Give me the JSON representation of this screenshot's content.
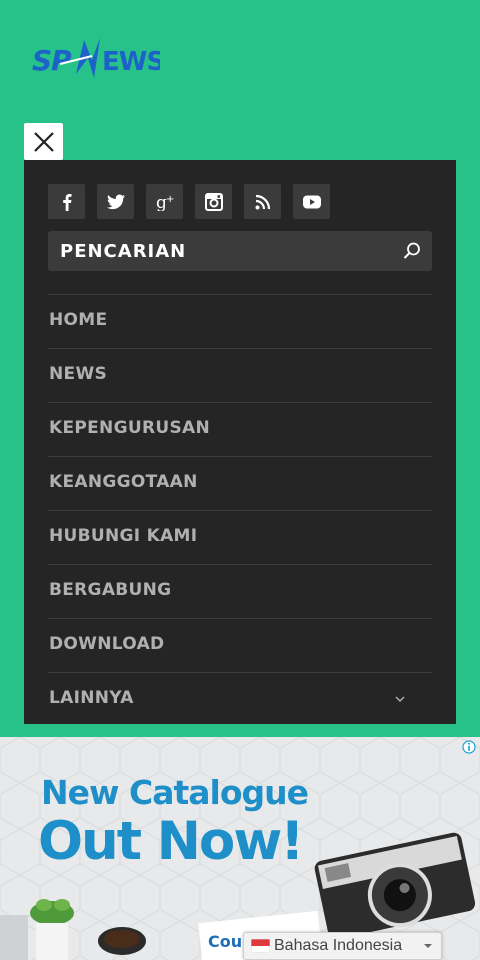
{
  "logo": {
    "text": "SPNEWS",
    "icon": "spnews-logo"
  },
  "close_button": {
    "icon": "close-icon"
  },
  "social": [
    {
      "name": "facebook",
      "icon": "facebook-icon"
    },
    {
      "name": "twitter",
      "icon": "twitter-icon"
    },
    {
      "name": "google-plus",
      "icon": "google-plus-icon"
    },
    {
      "name": "instagram",
      "icon": "instagram-icon"
    },
    {
      "name": "rss",
      "icon": "rss-icon"
    },
    {
      "name": "youtube",
      "icon": "youtube-icon"
    }
  ],
  "search": {
    "placeholder": "PENCARIAN",
    "icon": "search-icon"
  },
  "nav": {
    "items": [
      {
        "label": "HOME"
      },
      {
        "label": "NEWS"
      },
      {
        "label": "KEPENGURUSAN"
      },
      {
        "label": "KEANGGOTAAN"
      },
      {
        "label": "HUBUNGI KAMI"
      },
      {
        "label": "BERGABUNG"
      },
      {
        "label": "DOWNLOAD"
      },
      {
        "label": "LAINNYA",
        "icon": "chevron-down-icon"
      }
    ]
  },
  "ad": {
    "headline_line1": "New Catalogue",
    "headline_line2": "Out Now!",
    "info_icon": "info-icon"
  },
  "language": {
    "selected": "Bahasa Indonesia",
    "flag": "indonesia-flag-icon"
  },
  "colors": {
    "page_background": "#26c28a",
    "menu_background": "#252525",
    "button_background": "#3b3b3b",
    "nav_text": "#b0b0b0",
    "ad_text": "#1e8fc9",
    "logo": "#1c62c9"
  }
}
